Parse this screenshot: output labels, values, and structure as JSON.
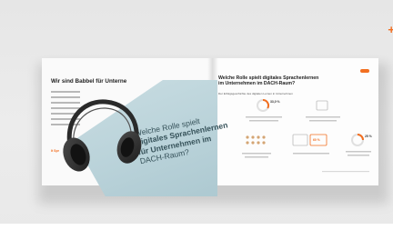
{
  "scene": "photo-of-open-booklet",
  "colors": {
    "accent": "#f26f21",
    "cover": "#bcd3d9",
    "cover_text": "#36525a",
    "background": "#e8e8e8"
  },
  "left_page": {
    "title": "Wir sind Babbel für Unterne",
    "footer": "It Spr"
  },
  "cover": {
    "label": "",
    "title_line1": "Welche Rolle spielt",
    "title_line2": "digitales Sprachenlernen",
    "title_line3": "für Unternehmen im",
    "title_line4": "DACH-Raum?"
  },
  "right_page": {
    "title_line1": "Welche Rolle spielt digitales Sprachenlernen",
    "title_line2": "im Unternehmen im DACH-Raum?",
    "subtitle": "Der Erfolgsgeschichte des digitalen Lernen in Unternehmen",
    "stats": [
      {
        "value": "33,0 %"
      },
      {
        "value": "60 %"
      },
      {
        "value": "25 %"
      }
    ]
  },
  "brand_glyph": "+"
}
